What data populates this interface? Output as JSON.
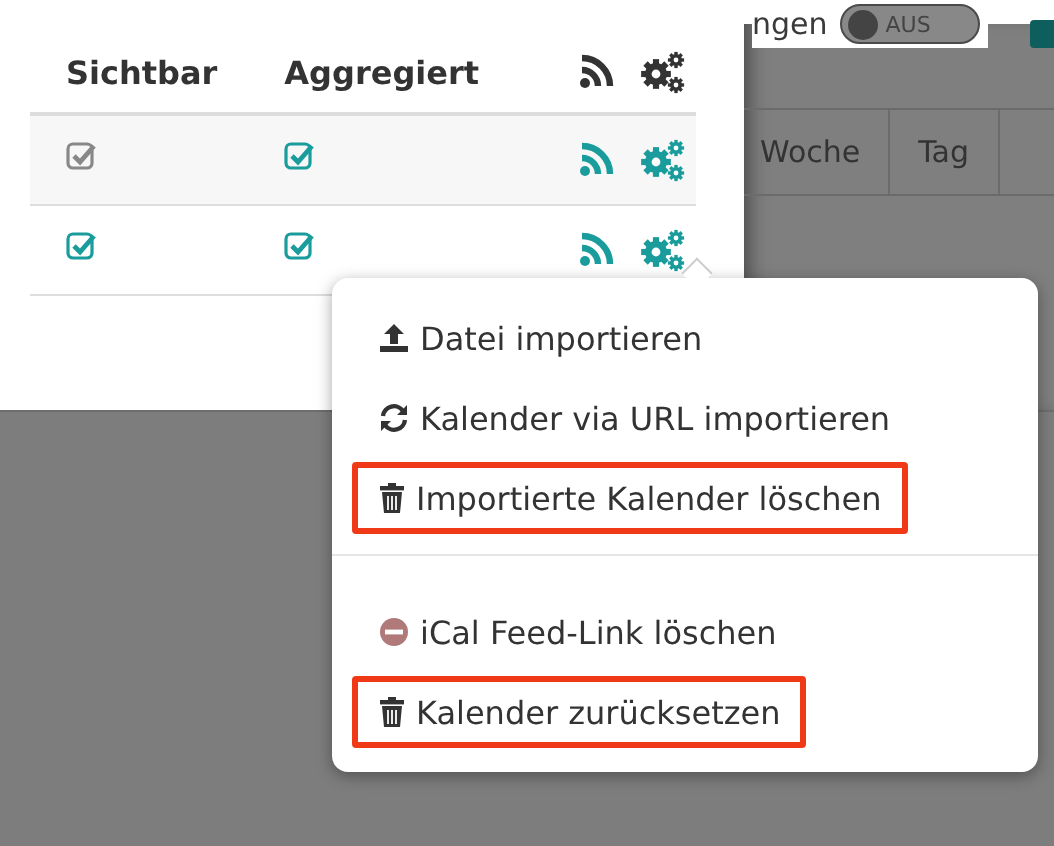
{
  "calendar_table": {
    "columns": [
      "Sichtbar",
      "Aggregiert"
    ],
    "rows": [
      {
        "visible": true,
        "visible_enabled": false,
        "aggregated": true
      },
      {
        "visible": true,
        "visible_enabled": true,
        "aggregated": true
      }
    ]
  },
  "background": {
    "settings_label": "ngen",
    "toggle": {
      "label": "AUS",
      "on": false
    },
    "view_tabs": [
      "Woche",
      "Tag"
    ]
  },
  "menu": {
    "groups": [
      [
        {
          "kind": "upload",
          "label": "Datei importieren",
          "highlighted": false
        },
        {
          "kind": "sync",
          "label": "Kalender via URL importieren",
          "highlighted": false
        },
        {
          "kind": "trash",
          "label": "Importierte Kalender löschen",
          "highlighted": true
        }
      ],
      [
        {
          "kind": "remove",
          "label": "iCal Feed-Link löschen",
          "highlighted": false
        },
        {
          "kind": "trash",
          "label": "Kalender zurücksetzen",
          "highlighted": true
        }
      ]
    ]
  }
}
